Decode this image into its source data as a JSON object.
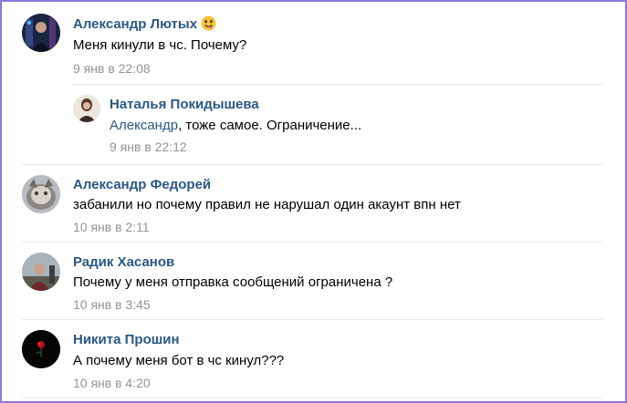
{
  "comments": [
    {
      "author": "Александр Лютых",
      "author_emoji_icon": "drooling-face-icon",
      "text": "Меня кинули в чс. Почему?",
      "time": "9 янв в 22:08",
      "reply": {
        "author": "Наталья Покидышева",
        "reply_to": "Александр",
        "text": ", тоже самое. Ограничение...",
        "time": "9 янв в 22:12"
      }
    },
    {
      "author": "Александр Федорей",
      "text": "забанили но почему правил не нарушал один акаунт впн нет",
      "time": "10 янв в 2:11"
    },
    {
      "author": "Радик Хасанов",
      "text": "Почему у меня отправка сообщений ограничена ?",
      "time": "10 янв в 3:45"
    },
    {
      "author": "Никита Прошин",
      "text": "А почему меня бот в чс кинул???",
      "time": "10 янв в 4:20"
    }
  ]
}
